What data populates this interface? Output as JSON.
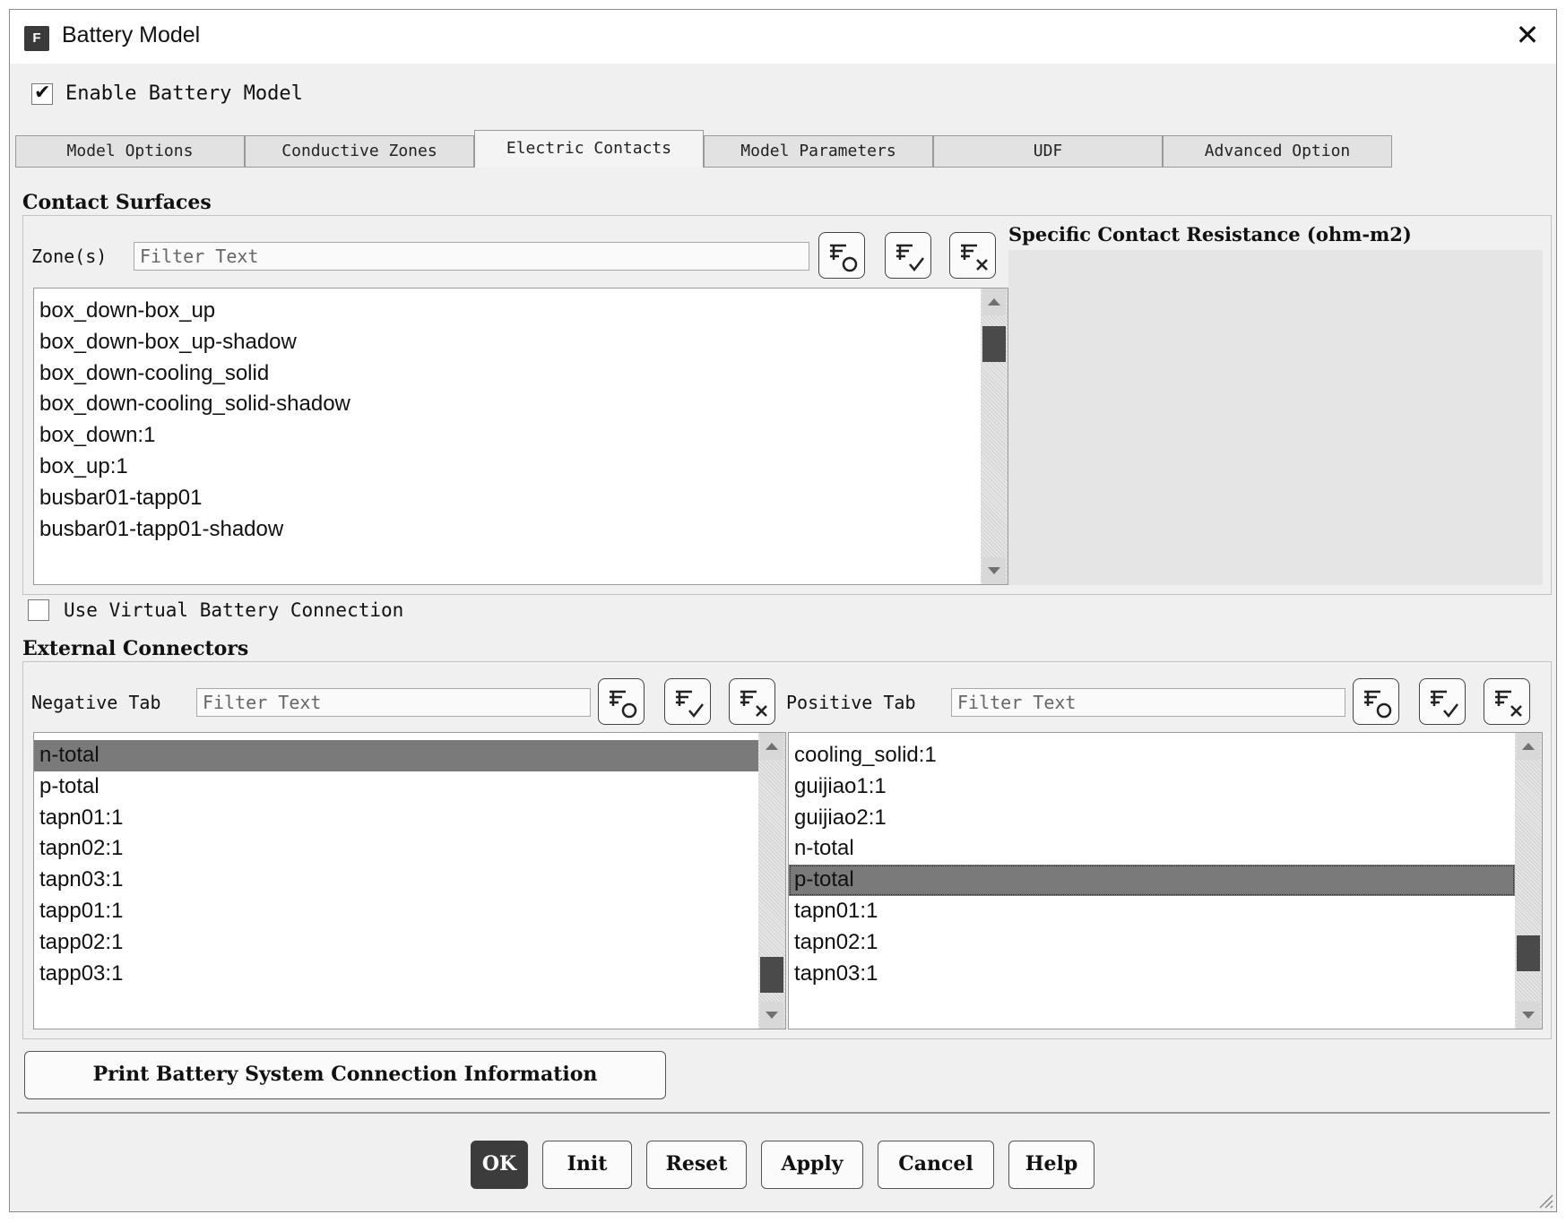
{
  "window": {
    "title": "Battery Model",
    "app_icon_letter": "F",
    "close_symbol": "✕"
  },
  "enable": {
    "label": "Enable Battery Model",
    "checked": true
  },
  "tabs": [
    {
      "label": "Model Options",
      "active": false
    },
    {
      "label": "Conductive Zones",
      "active": false
    },
    {
      "label": "Electric Contacts",
      "active": true
    },
    {
      "label": "Model Parameters",
      "active": false
    },
    {
      "label": "UDF",
      "active": false
    },
    {
      "label": "Advanced Option",
      "active": false
    }
  ],
  "contact_surfaces": {
    "title": "Contact Surfaces",
    "zones_label": "Zone(s)",
    "filter_placeholder": "Filter Text",
    "resistance_label": "Specific Contact Resistance (ohm-m2)",
    "items": [
      "box_down-box_up",
      "box_down-box_up-shadow",
      "box_down-cooling_solid",
      "box_down-cooling_solid-shadow",
      "box_down:1",
      "box_up:1",
      "busbar01-tapp01",
      "busbar01-tapp01-shadow"
    ]
  },
  "virtual_connection": {
    "label": "Use Virtual Battery Connection",
    "checked": false
  },
  "external_connectors": {
    "title": "External Connectors",
    "negative": {
      "label": "Negative Tab",
      "filter_placeholder": "Filter Text",
      "items": [
        "n-total",
        "p-total",
        "tapn01:1",
        "tapn02:1",
        "tapn03:1",
        "tapp01:1",
        "tapp02:1",
        "tapp03:1"
      ],
      "selected": "n-total"
    },
    "positive": {
      "label": "Positive Tab",
      "filter_placeholder": "Filter Text",
      "items": [
        "cooling_solid:1",
        "guijiao1:1",
        "guijiao2:1",
        "n-total",
        "p-total",
        "tapn01:1",
        "tapn02:1",
        "tapn03:1"
      ],
      "selected": "p-total"
    }
  },
  "print_button": "Print Battery System Connection Information",
  "footer_buttons": [
    "OK",
    "Init",
    "Reset",
    "Apply",
    "Cancel",
    "Help"
  ],
  "icons": {
    "filter_buttons": [
      "filter-reset-icon",
      "select-all-icon",
      "deselect-all-icon"
    ]
  },
  "colors": {
    "selection": "#7a7a7a",
    "default_button": "#3c3c3c",
    "panel": "#f0f0f0"
  }
}
